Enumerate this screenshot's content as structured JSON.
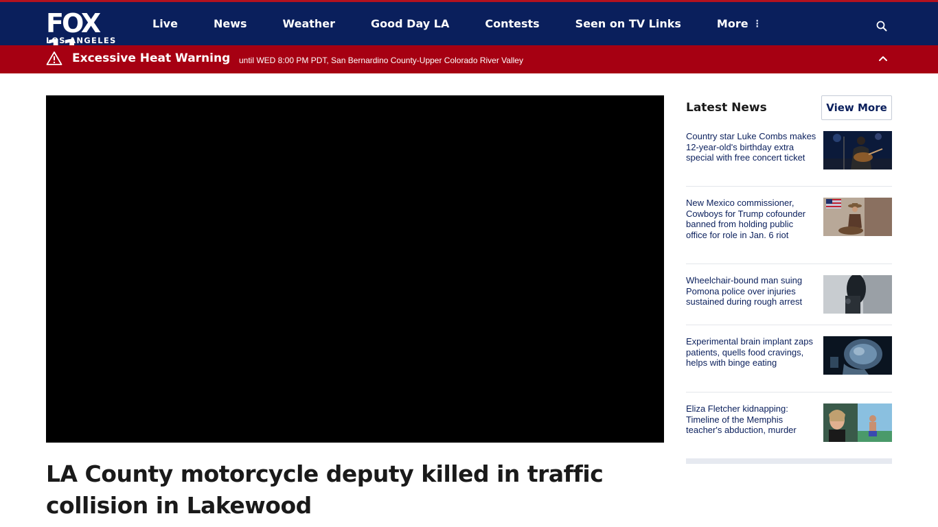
{
  "logo": {
    "main": "FOX 11",
    "sub": "LOS ANGELES"
  },
  "nav": {
    "items": [
      {
        "label": "Live"
      },
      {
        "label": "News"
      },
      {
        "label": "Weather"
      },
      {
        "label": "Good Day LA"
      },
      {
        "label": "Contests"
      },
      {
        "label": "Seen on TV Links"
      }
    ],
    "more_label": "More",
    "more_icon": "vertical-dots-icon",
    "search_icon": "search-icon"
  },
  "alert": {
    "icon": "warning-triangle-icon",
    "title": "Excessive Heat Warning",
    "text": "until WED 8:00 PM PDT, San Bernardino County-Upper Colorado River Valley",
    "toggle_icon": "chevron-up-icon"
  },
  "article": {
    "headline": "LA County motorcycle deputy killed in traffic collision in Lakewood"
  },
  "sidebar": {
    "title": "Latest News",
    "view_more": "View More",
    "items": [
      {
        "text": "Country star Luke Combs makes 12-year-old's birthday extra special with free concert ticket"
      },
      {
        "text": "New Mexico commissioner, Cowboys for Trump cofounder banned from holding public office for role in Jan. 6 riot"
      },
      {
        "text": "Wheelchair-bound man suing Pomona police over injuries sustained during rough arrest"
      },
      {
        "text": "Experimental brain implant zaps patients, quells food cravings, helps with binge eating"
      },
      {
        "text": "Eliza Fletcher kidnapping: Timeline of the Memphis teacher's abduction, murder"
      }
    ]
  },
  "colors": {
    "header_bg": "#0a1f5c",
    "alert_bg": "#a60012",
    "link": "#0a1f5c"
  }
}
